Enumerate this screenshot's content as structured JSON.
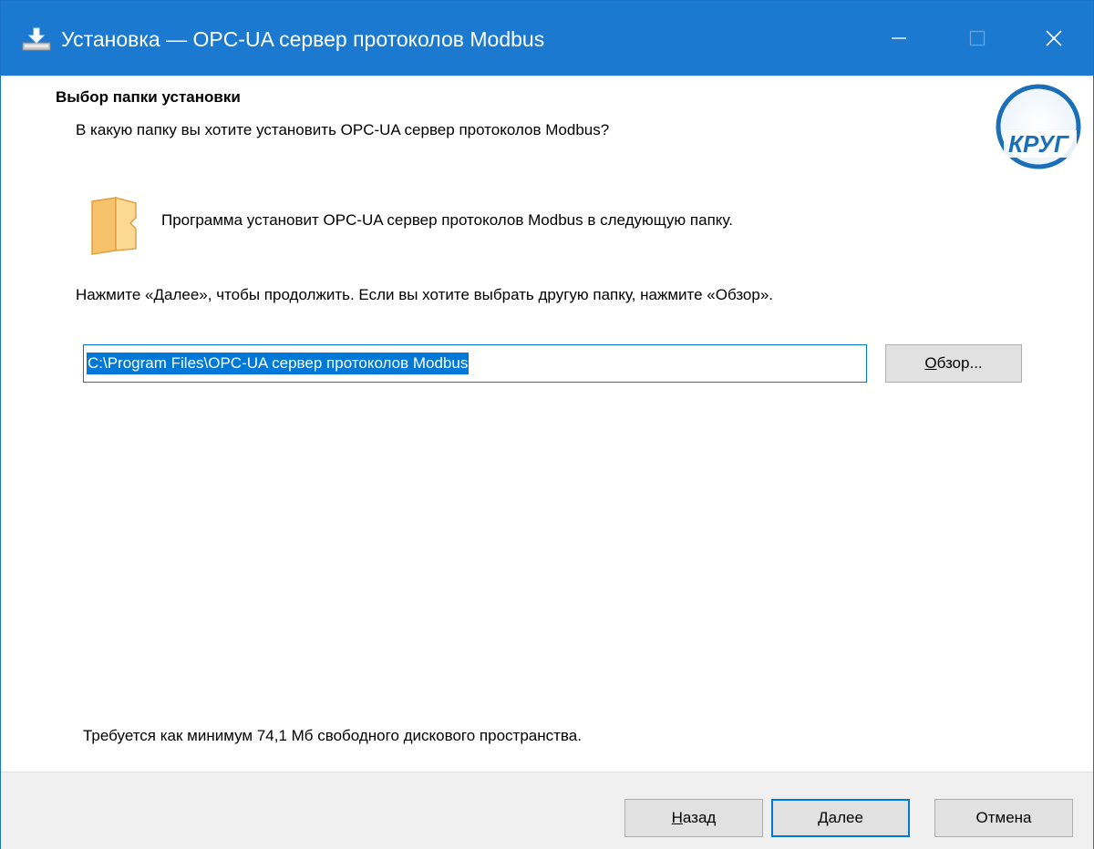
{
  "window": {
    "title": "Установка — OPC-UA сервер протоколов Modbus",
    "controls": {
      "minimize": "minimize",
      "maximize": "maximize",
      "close": "close"
    }
  },
  "header": {
    "heading": "Выбор папки установки",
    "subheading": "В какую папку вы хотите установить OPC-UA сервер протоколов Modbus?",
    "logo_text": "КРУГ"
  },
  "body": {
    "info": "Программа установит OPC-UA сервер протоколов Modbus в следующую папку.",
    "hint": "Нажмите «Далее», чтобы продолжить. Если вы хотите выбрать другую папку, нажмите «Обзор».",
    "path_value": "C:\\Program Files\\OPC-UA сервер протоколов Modbus",
    "browse_accel": "О",
    "browse_rest": "бзор...",
    "space_required": "Требуется как минимум 74,1 Мб свободного дискового пространства."
  },
  "footer": {
    "back_accel": "Н",
    "back_rest": "азад",
    "next_accel": "Д",
    "next_rest": "алее",
    "cancel_label": "Отмена"
  },
  "colors": {
    "titlebar": "#1b79cf",
    "selection": "#0078d7",
    "footer": "#f0f0f0",
    "button": "#e1e1e1"
  },
  "icons": {
    "app": "installer-icon",
    "folder": "folder-icon",
    "logo": "krug-logo"
  }
}
